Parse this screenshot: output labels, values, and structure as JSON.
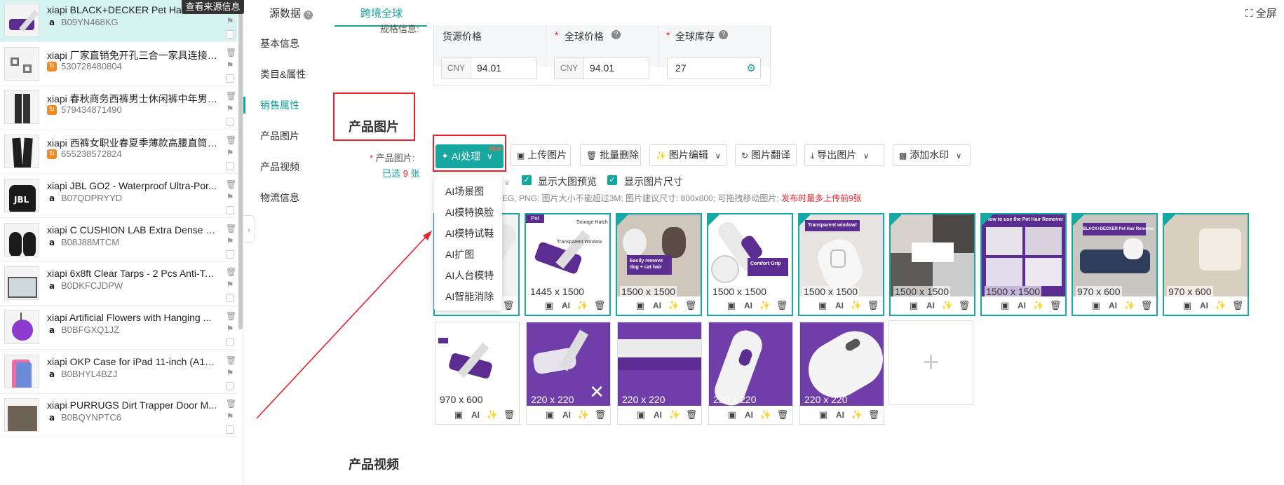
{
  "tooltip": "查看来源信息",
  "fullscreen": "全屏",
  "products": [
    {
      "title": "xiapi BLACK+DECKER Pet Hair Remover",
      "sku": "B09YN468KG",
      "source": "amazon"
    },
    {
      "title": "xiapi 厂家直销免开孔三合一家具连接件...",
      "sku": "530728480804",
      "source": "1688"
    },
    {
      "title": "xiapi 春秋商务西裤男士休闲裤中年男裤...",
      "sku": "579434871490",
      "source": "1688"
    },
    {
      "title": "xiapi 西裤女职业春夏季薄款高腰直筒垂...",
      "sku": "655238572824",
      "source": "1688"
    },
    {
      "title": "xiapi JBL GO2 - Waterproof Ultra-Por...",
      "sku": "B07QDPRYYD",
      "source": "amazon"
    },
    {
      "title": "xiapi C CUSHION LAB Extra Dense Lu...",
      "sku": "B08J88MTCM",
      "source": "amazon"
    },
    {
      "title": "xiapi 6x8ft Clear Tarps - 2 Pcs Anti-Te...",
      "sku": "B0DKFCJDPW",
      "source": "amazon"
    },
    {
      "title": "xiapi Artificial Flowers with Hanging ...",
      "sku": "B0BFGXQ1JZ",
      "source": "amazon"
    },
    {
      "title": "xiapi OKP Case for iPad 11-inch (A16...",
      "sku": "B0BHYL4BZJ",
      "source": "amazon"
    },
    {
      "title": "xiapi PURRUGS Dirt Trapper Door M...",
      "sku": "B0BQYNPTC6",
      "source": "amazon"
    }
  ],
  "tabs": {
    "source_data": "源数据",
    "cross_border": "跨境全球"
  },
  "nav": [
    "基本信息",
    "类目&属性",
    "销售属性",
    "产品图片",
    "产品视频",
    "物流信息"
  ],
  "spec_label": "规格信息:",
  "price_table": {
    "headers": [
      "货源价格",
      "全球价格",
      "全球库存"
    ],
    "source_price": {
      "currency": "CNY",
      "value": "94.01"
    },
    "global_price": {
      "currency": "CNY",
      "value": "94.01"
    },
    "stock": "27"
  },
  "images_section": {
    "title": "产品图片",
    "field_label": "产品图片:",
    "selected_prefix": "已选",
    "selected_count": "9",
    "selected_suffix": "张",
    "ai_button": "AI处理",
    "ai_badge": "NEW",
    "toolbar": [
      "上传图片",
      "批量删除",
      "图片编辑",
      "图片翻译",
      "导出图片",
      "添加水印"
    ],
    "show_big_preview": "显示大图预览",
    "show_size": "显示图片尺寸",
    "hint": "EG, PNG; 图片大小不能超过3M; 图片建议尺寸: 800x800; 可拖拽移动图片;",
    "hint_warning": "发布时最多上传前9张",
    "ai_menu": [
      "AI场景图",
      "AI模特换脸",
      "AI模特试鞋",
      "AI扩图",
      "AI人台模特",
      "AI智能消除"
    ],
    "action_ai": "AI",
    "row1": [
      "1500 x 1500",
      "1445 x 1500",
      "1500 x 1500",
      "1500 x 1500",
      "1500 x 1500",
      "1500 x 1500",
      "1500 x 1500",
      "970 x 600",
      "970 x 600"
    ],
    "row2": [
      "970 x 600",
      "220 x 220",
      "220 x 220",
      "220 x 220",
      "220 x 220"
    ],
    "img_texts": {
      "storage_hatch": "Storage Hatch",
      "transparent_window": "Transparent Window",
      "easily_remove": "Easily remove dog + cat hair",
      "comfort_grip": "Comfort Grip",
      "transparent_window2": "Transparent window!",
      "how_to_use": "How to use the Pet Hair Remover",
      "brand_banner": "BLACK+DECKER Pet Hair Remover",
      "pet_badge": "Pet"
    }
  },
  "video_section": {
    "title": "产品视频"
  }
}
